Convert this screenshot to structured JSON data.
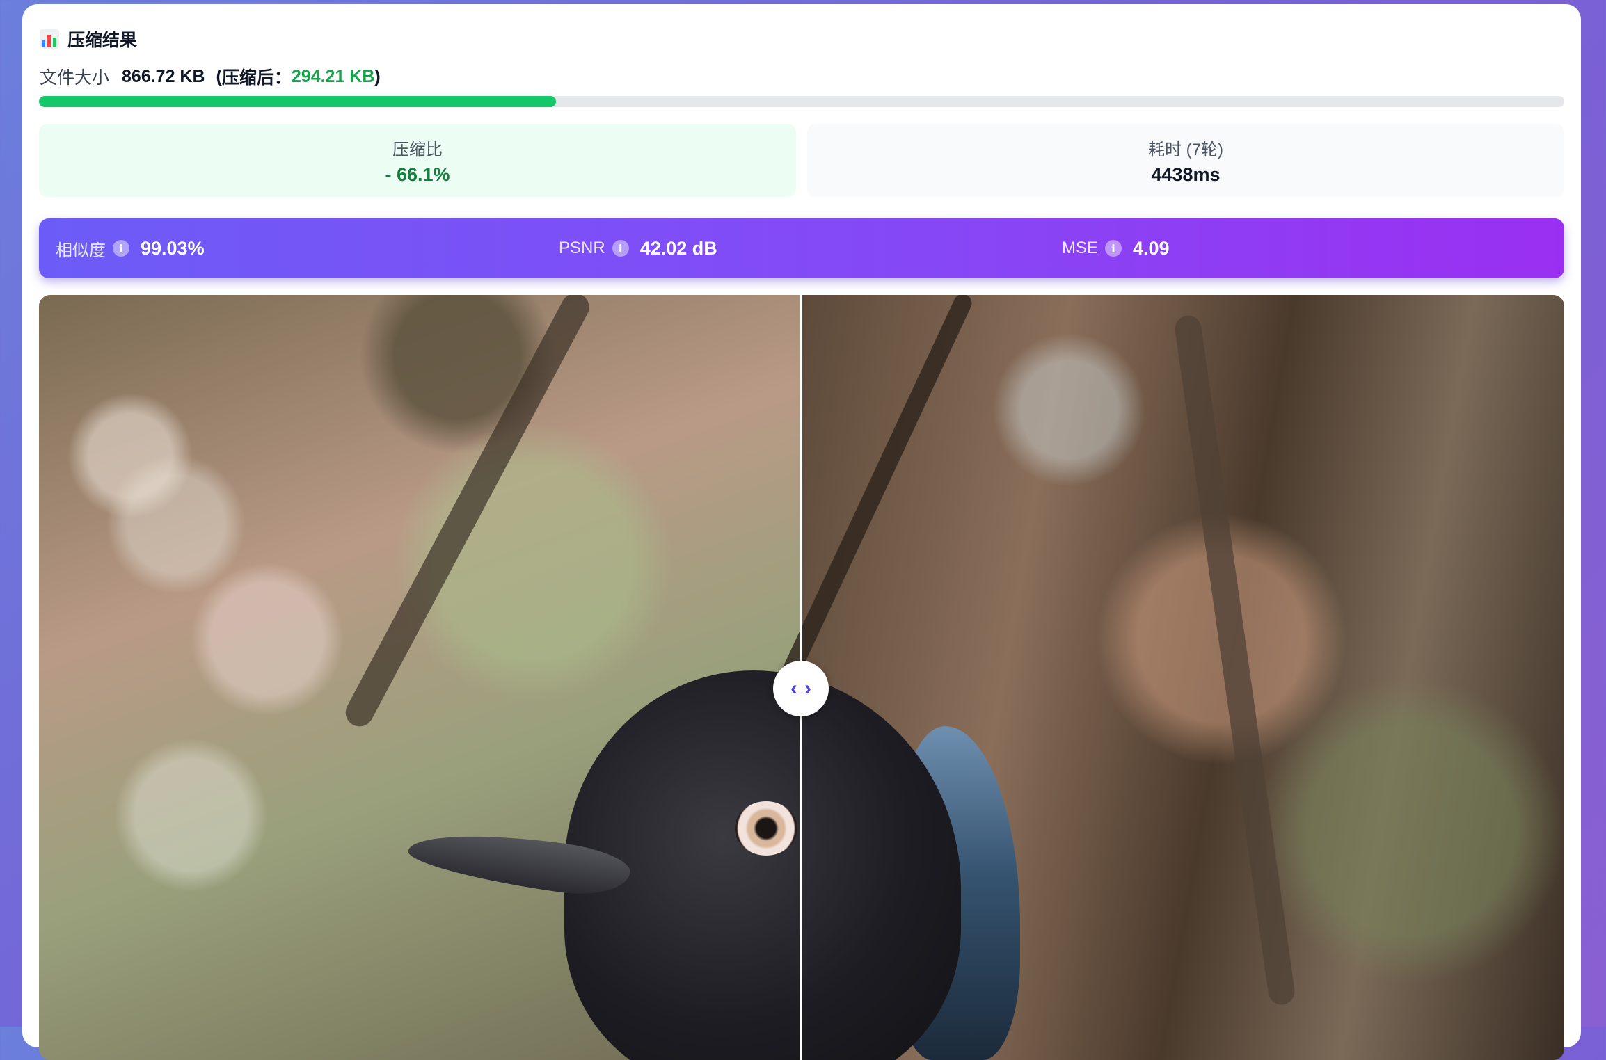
{
  "header": {
    "icon": "bar-chart-icon",
    "title": "压缩结果"
  },
  "file_size": {
    "label": "文件大小",
    "original": "866.72 KB",
    "open_paren": "(",
    "after_label": "压缩后：",
    "compressed": "294.21 KB",
    "close_paren": ")",
    "progress_fraction": 0.339
  },
  "stats": {
    "ratio_label": "压缩比",
    "ratio_value": "- 66.1%",
    "time_label": "耗时 (7轮)",
    "time_value": "4438ms"
  },
  "metrics": {
    "similarity_label": "相似度",
    "similarity_value": "99.03%",
    "psnr_label": "PSNR",
    "psnr_value": "42.02 dB",
    "mse_label": "MSE",
    "mse_value": "4.09",
    "info_glyph": "i"
  },
  "compare": {
    "slider_fraction": 0.5,
    "handle_left": "‹",
    "handle_right": "›"
  },
  "colors": {
    "accent_green": "#16a34a",
    "progress": "#16c76a",
    "metrics_gradient_start": "#6c5cf7",
    "metrics_gradient_end": "#9a2ff2",
    "handle_arrows": "#4f46e5"
  }
}
